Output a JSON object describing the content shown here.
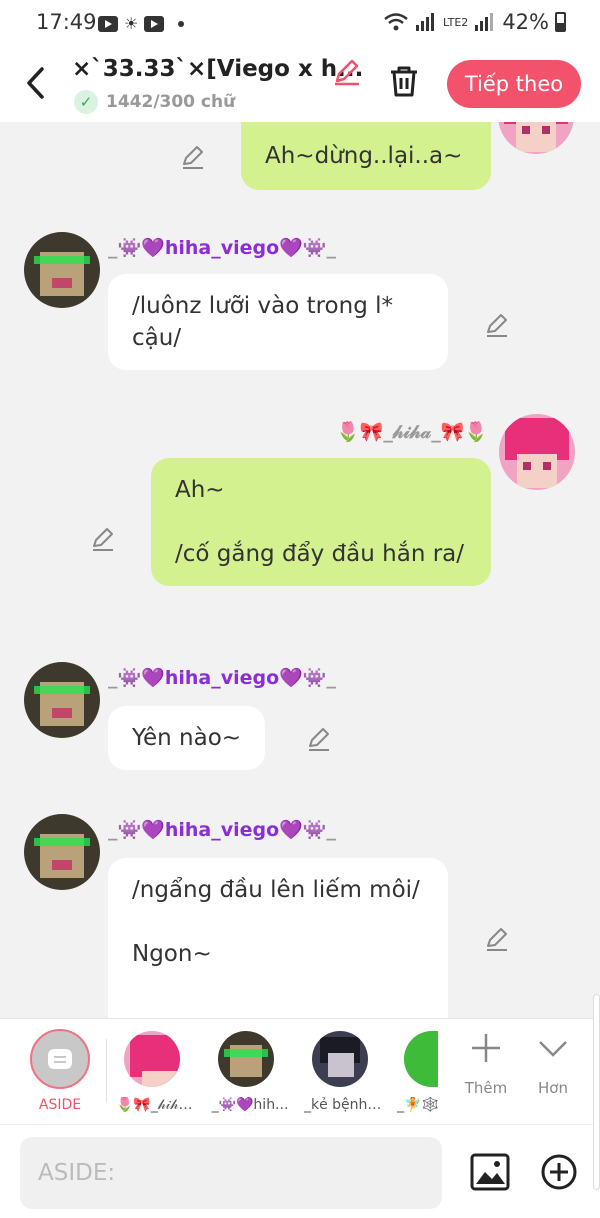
{
  "status_bar": {
    "time": "17:49",
    "battery": "42%",
    "network": "LTE2"
  },
  "header": {
    "title": "×`33.33`×[Viego x h...",
    "word_count": "1442/300 chữ",
    "next_label": "Tiếp theo"
  },
  "messages": [
    {
      "side": "right",
      "text": "Ah~dừng..lại..a~"
    },
    {
      "side": "left",
      "name_prefix": "_👾💜",
      "name_core": "hiha_viego",
      "name_suffix": "💜👾_",
      "text": "/luônz lưỡi vào trong l* cậu/"
    },
    {
      "side": "right",
      "name": "🌷🎀_𝒽𝒾𝒽𝒶_🎀🌷",
      "text": "Ah~\n\n/cố gắng đẩy đầu hắn ra/"
    },
    {
      "side": "left",
      "name_prefix": "_👾💜",
      "name_core": "hiha_viego",
      "name_suffix": "💜👾_",
      "text": "Yên nào~"
    },
    {
      "side": "left",
      "name_prefix": "_👾💜",
      "name_core": "hiha_viego",
      "name_suffix": "💜👾_",
      "text": "/ngẩng đầu lên liếm môi/\n\nNgon~"
    }
  ],
  "character_bar": {
    "aside_label": "ASIDE",
    "characters": [
      {
        "label": "🌷🎀_𝒽𝒾𝒽𝒶..."
      },
      {
        "label": "_👾💜hih..."
      },
      {
        "label": "_kẻ bệnh ..."
      },
      {
        "label": "_🧚🕸️"
      }
    ],
    "more_label": "Thêm",
    "less_label": "Hơn"
  },
  "input": {
    "placeholder": "ASIDE:"
  },
  "colors": {
    "accent": "#f2526b",
    "bubble_green": "#d4f18f",
    "name_purple": "#8a2ed8"
  }
}
